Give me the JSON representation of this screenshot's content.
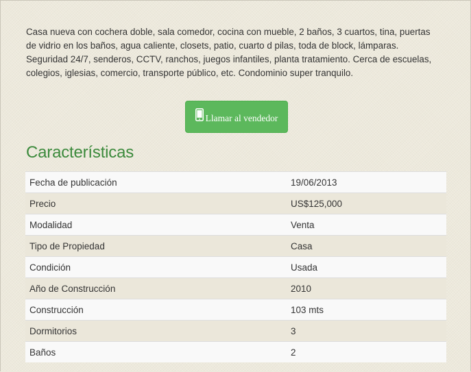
{
  "listing": {
    "description": "Casa nueva con cochera doble, sala comedor, cocina con mueble, 2 baños, 3 cuartos, tina, puertas de vidrio en los baños, agua caliente, closets, patio, cuarto d pilas, toda de block, lámparas. Seguridad 24/7, senderos, CCTV, ranchos, juegos infantiles, planta tratamiento. Cerca de escuelas, colegios, iglesias, comercio, transporte público, etc. Condominio super tranquilo."
  },
  "contact": {
    "call_label": "Llamar al vendedor",
    "icon": "mobile-phone-icon",
    "button_color": "#5cb85c"
  },
  "features": {
    "title": "Características",
    "title_color": "#3c8a3c",
    "rows": [
      {
        "label": "Fecha de publicación",
        "value": "19/06/2013"
      },
      {
        "label": "Precio",
        "value": "US$125,000"
      },
      {
        "label": "Modalidad",
        "value": "Venta"
      },
      {
        "label": "Tipo de Propiedad",
        "value": "Casa"
      },
      {
        "label": "Condición",
        "value": "Usada"
      },
      {
        "label": "Año de Construcción",
        "value": "2010"
      },
      {
        "label": "Construcción",
        "value": "103 mts"
      },
      {
        "label": "Dormitorios",
        "value": "3"
      },
      {
        "label": "Baños",
        "value": "2"
      }
    ]
  }
}
